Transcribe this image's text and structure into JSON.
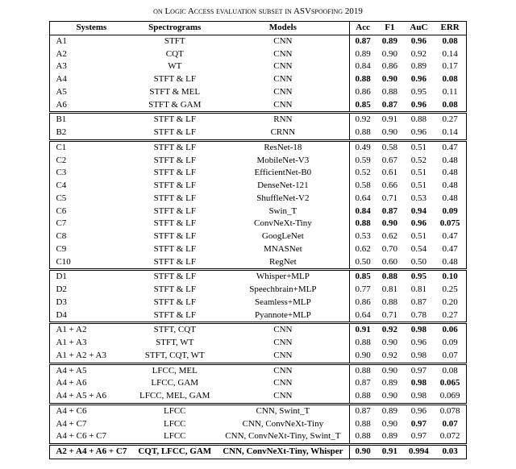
{
  "caption": "on Logic Access evaluation subset in ASVspoofing 2019",
  "columns": [
    "Systems",
    "Spectrograms",
    "Models",
    "Acc",
    "F1",
    "AuC",
    "ERR"
  ],
  "chart_data": {
    "type": "table",
    "columns": [
      "Systems",
      "Spectrograms",
      "Models",
      "Acc",
      "F1",
      "AuC",
      "ERR"
    ],
    "groups": [
      {
        "rows": [
          {
            "system": "A1",
            "spec": "STFT",
            "model": "CNN",
            "acc": {
              "v": "0.87",
              "b": true
            },
            "f1": {
              "v": "0.89",
              "b": true
            },
            "auc": {
              "v": "0.96",
              "b": true
            },
            "err": {
              "v": "0.08",
              "b": true
            }
          },
          {
            "system": "A2",
            "spec": "CQT",
            "model": "CNN",
            "acc": {
              "v": "0.89"
            },
            "f1": {
              "v": "0.90"
            },
            "auc": {
              "v": "0.92"
            },
            "err": {
              "v": "0.14"
            }
          },
          {
            "system": "A3",
            "spec": "WT",
            "model": "CNN",
            "acc": {
              "v": "0.84"
            },
            "f1": {
              "v": "0.86"
            },
            "auc": {
              "v": "0.89"
            },
            "err": {
              "v": "0.17"
            }
          },
          {
            "system": "A4",
            "spec": "STFT & LF",
            "model": "CNN",
            "acc": {
              "v": "0.88",
              "b": true
            },
            "f1": {
              "v": "0.90",
              "b": true
            },
            "auc": {
              "v": "0.96",
              "b": true
            },
            "err": {
              "v": "0.08",
              "b": true
            }
          },
          {
            "system": "A5",
            "spec": "STFT & MEL",
            "model": "CNN",
            "acc": {
              "v": "0.86"
            },
            "f1": {
              "v": "0.88"
            },
            "auc": {
              "v": "0.95"
            },
            "err": {
              "v": "0.11"
            }
          },
          {
            "system": "A6",
            "spec": "STFT & GAM",
            "model": "CNN",
            "acc": {
              "v": "0.85",
              "b": true
            },
            "f1": {
              "v": "0.87",
              "b": true
            },
            "auc": {
              "v": "0.96",
              "b": true
            },
            "err": {
              "v": "0.08",
              "b": true
            }
          }
        ]
      },
      {
        "rows": [
          {
            "system": "B1",
            "spec": "STFT & LF",
            "model": "RNN",
            "acc": {
              "v": "0.92"
            },
            "f1": {
              "v": "0.91"
            },
            "auc": {
              "v": "0.88"
            },
            "err": {
              "v": "0.27"
            }
          },
          {
            "system": "B2",
            "spec": "STFT & LF",
            "model": "CRNN",
            "acc": {
              "v": "0.88"
            },
            "f1": {
              "v": "0.90"
            },
            "auc": {
              "v": "0.96"
            },
            "err": {
              "v": "0.14"
            }
          }
        ]
      },
      {
        "rows": [
          {
            "system": "C1",
            "spec": "STFT & LF",
            "model": "ResNet-18",
            "acc": {
              "v": "0.49"
            },
            "f1": {
              "v": "0.58"
            },
            "auc": {
              "v": "0.51"
            },
            "err": {
              "v": "0.47"
            }
          },
          {
            "system": "C2",
            "spec": "STFT & LF",
            "model": "MobileNet-V3",
            "acc": {
              "v": "0.59"
            },
            "f1": {
              "v": "0.67"
            },
            "auc": {
              "v": "0.52"
            },
            "err": {
              "v": "0.48"
            }
          },
          {
            "system": "C3",
            "spec": "STFT & LF",
            "model": "EfficientNet-B0",
            "acc": {
              "v": "0.52"
            },
            "f1": {
              "v": "0.61"
            },
            "auc": {
              "v": "0.51"
            },
            "err": {
              "v": "0.48"
            }
          },
          {
            "system": "C4",
            "spec": "STFT & LF",
            "model": "DenseNet-121",
            "acc": {
              "v": "0.58"
            },
            "f1": {
              "v": "0.66"
            },
            "auc": {
              "v": "0.51"
            },
            "err": {
              "v": "0.48"
            }
          },
          {
            "system": "C5",
            "spec": "STFT & LF",
            "model": "ShuffleNet-V2",
            "acc": {
              "v": "0.64"
            },
            "f1": {
              "v": "0.71"
            },
            "auc": {
              "v": "0.53"
            },
            "err": {
              "v": "0.48"
            }
          },
          {
            "system": "C6",
            "spec": "STFT & LF",
            "model": "Swin_T",
            "acc": {
              "v": "0.84",
              "b": true
            },
            "f1": {
              "v": "0.87",
              "b": true
            },
            "auc": {
              "v": "0.94",
              "b": true
            },
            "err": {
              "v": "0.09",
              "b": true
            }
          },
          {
            "system": "C7",
            "spec": "STFT & LF",
            "model": "ConvNeXt-Tiny",
            "acc": {
              "v": "0.88",
              "b": true
            },
            "f1": {
              "v": "0.90",
              "b": true
            },
            "auc": {
              "v": "0.96",
              "b": true
            },
            "err": {
              "v": "0.075",
              "b": true
            }
          },
          {
            "system": "C8",
            "spec": "STFT & LF",
            "model": "GoogLeNet",
            "acc": {
              "v": "0.53"
            },
            "f1": {
              "v": "0.62"
            },
            "auc": {
              "v": "0.51"
            },
            "err": {
              "v": "0.47"
            }
          },
          {
            "system": "C9",
            "spec": "STFT & LF",
            "model": "MNASNet",
            "acc": {
              "v": "0.62"
            },
            "f1": {
              "v": "0.70"
            },
            "auc": {
              "v": "0.54"
            },
            "err": {
              "v": "0.47"
            }
          },
          {
            "system": "C10",
            "spec": "STFT & LF",
            "model": "RegNet",
            "acc": {
              "v": "0.50"
            },
            "f1": {
              "v": "0.60"
            },
            "auc": {
              "v": "0.50"
            },
            "err": {
              "v": "0.48"
            }
          }
        ]
      },
      {
        "rows": [
          {
            "system": "D1",
            "spec": "STFT & LF",
            "model": "Whisper+MLP",
            "acc": {
              "v": "0.85",
              "b": true
            },
            "f1": {
              "v": "0.88",
              "b": true
            },
            "auc": {
              "v": "0.95",
              "b": true
            },
            "err": {
              "v": "0.10",
              "b": true
            }
          },
          {
            "system": "D2",
            "spec": "STFT & LF",
            "model": "Speechbrain+MLP",
            "acc": {
              "v": "0.77"
            },
            "f1": {
              "v": "0.81"
            },
            "auc": {
              "v": "0.81"
            },
            "err": {
              "v": "0.25"
            }
          },
          {
            "system": "D3",
            "spec": "STFT & LF",
            "model": "Seamless+MLP",
            "acc": {
              "v": "0.86"
            },
            "f1": {
              "v": "0.88"
            },
            "auc": {
              "v": "0.87"
            },
            "err": {
              "v": "0.20"
            }
          },
          {
            "system": "D4",
            "spec": "STFT & LF",
            "model": "Pyannote+MLP",
            "acc": {
              "v": "0.64"
            },
            "f1": {
              "v": "0.71"
            },
            "auc": {
              "v": "0.78"
            },
            "err": {
              "v": "0.27"
            }
          }
        ]
      },
      {
        "rows": [
          {
            "system": "A1 + A2",
            "spec": "STFT, CQT",
            "model": "CNN",
            "acc": {
              "v": "0.91",
              "b": true
            },
            "f1": {
              "v": "0.92",
              "b": true
            },
            "auc": {
              "v": "0.98",
              "b": true
            },
            "err": {
              "v": "0.06",
              "b": true
            }
          },
          {
            "system": "A1 + A3",
            "spec": "STFT, WT",
            "model": "CNN",
            "acc": {
              "v": "0.88"
            },
            "f1": {
              "v": "0.90"
            },
            "auc": {
              "v": "0.96"
            },
            "err": {
              "v": "0.09"
            }
          },
          {
            "system": "A1 + A2 + A3",
            "spec": "STFT, CQT, WT",
            "model": "CNN",
            "acc": {
              "v": "0.90"
            },
            "f1": {
              "v": "0.92"
            },
            "auc": {
              "v": "0.98"
            },
            "err": {
              "v": "0.07"
            }
          }
        ]
      },
      {
        "rows": [
          {
            "system": "A4 + A5",
            "spec": "LFCC, MEL",
            "model": "CNN",
            "acc": {
              "v": "0.88"
            },
            "f1": {
              "v": "0.90"
            },
            "auc": {
              "v": "0.97"
            },
            "err": {
              "v": "0.08"
            }
          },
          {
            "system": "A4 + A6",
            "spec": "LFCC, GAM",
            "model": "CNN",
            "acc": {
              "v": "0.87"
            },
            "f1": {
              "v": "0.89"
            },
            "auc": {
              "v": "0.98",
              "b": true
            },
            "err": {
              "v": "0.065",
              "b": true
            }
          },
          {
            "system": "A4 + A5 + A6",
            "spec": "LFCC, MEL, GAM",
            "model": "CNN",
            "acc": {
              "v": "0.88"
            },
            "f1": {
              "v": "0.90"
            },
            "auc": {
              "v": "0.98"
            },
            "err": {
              "v": "0.069"
            }
          }
        ]
      },
      {
        "rows": [
          {
            "system": "A4 + C6",
            "spec": "LFCC",
            "model": "CNN, Swint_T",
            "acc": {
              "v": "0.87"
            },
            "f1": {
              "v": "0.89"
            },
            "auc": {
              "v": "0.96"
            },
            "err": {
              "v": "0.078"
            }
          },
          {
            "system": "A4 + C7",
            "spec": "LFCC",
            "model": "CNN, ConvNeXt-Tiny",
            "acc": {
              "v": "0.88"
            },
            "f1": {
              "v": "0.90"
            },
            "auc": {
              "v": "0.97",
              "b": true
            },
            "err": {
              "v": "0.07",
              "b": true
            }
          },
          {
            "system": "A4 + C6 + C7",
            "spec": "LFCC",
            "model": "CNN, ConvNeXt-Tiny, Swint_T",
            "acc": {
              "v": "0.88"
            },
            "f1": {
              "v": "0.89"
            },
            "auc": {
              "v": "0.97"
            },
            "err": {
              "v": "0.072"
            }
          }
        ]
      },
      {
        "rows": [
          {
            "system": "A2 + A4 + A6 + C7",
            "sysBold": true,
            "spec": "CQT, LFCC, GAM",
            "specBold": true,
            "model": "CNN, ConvNeXt-Tiny, Whisper",
            "modelBold": true,
            "acc": {
              "v": "0.90",
              "b": true
            },
            "f1": {
              "v": "0.91",
              "b": true
            },
            "auc": {
              "v": "0.994",
              "b": true
            },
            "err": {
              "v": "0.03",
              "b": true
            }
          }
        ]
      }
    ]
  }
}
